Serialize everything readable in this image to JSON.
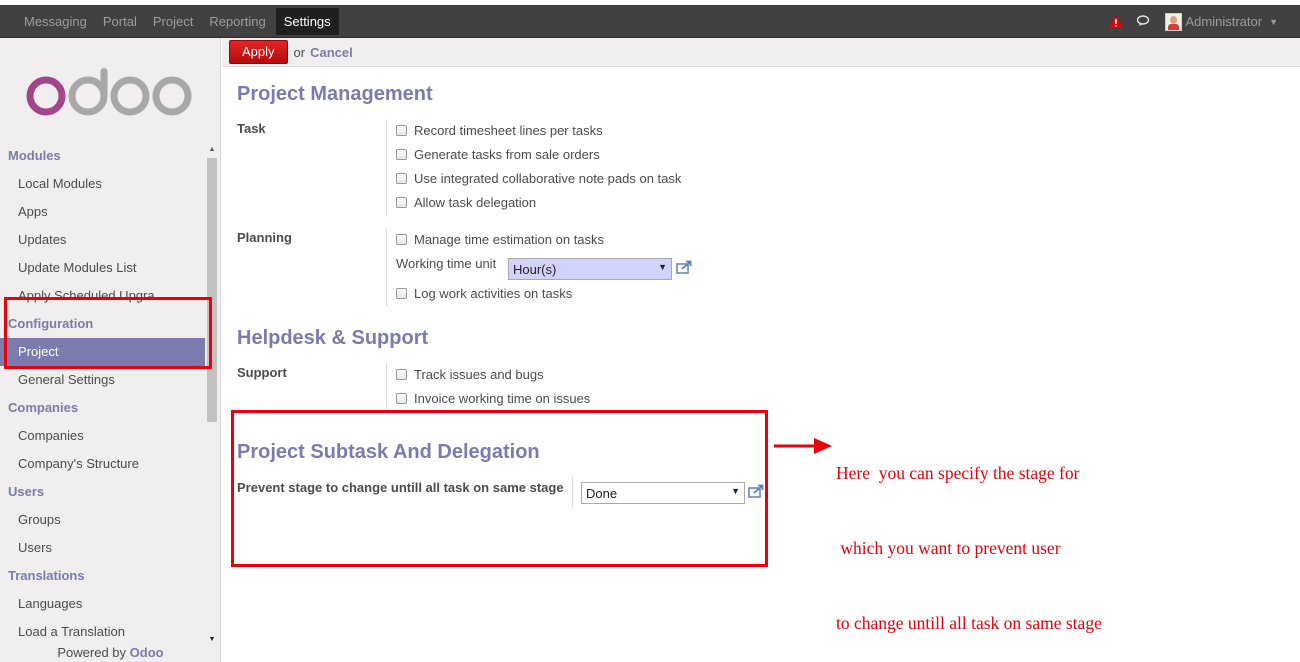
{
  "topbar": {
    "menu": [
      "Messaging",
      "Portal",
      "Project",
      "Reporting",
      "Settings"
    ],
    "active_menu": "Settings",
    "user_name": "Administrator"
  },
  "sidebar": {
    "sections": [
      {
        "title": "Modules",
        "items": [
          "Local Modules",
          "Apps",
          "Updates",
          "Update Modules List",
          "Apply Scheduled Upgra..."
        ]
      },
      {
        "title": "Configuration",
        "items": [
          "Project",
          "General Settings"
        ]
      },
      {
        "title": "Companies",
        "items": [
          "Companies",
          "Company's Structure"
        ]
      },
      {
        "title": "Users",
        "items": [
          "Groups",
          "Users"
        ]
      },
      {
        "title": "Translations",
        "items": [
          "Languages",
          "Load a Translation"
        ]
      }
    ],
    "active_item": "Project",
    "powered_by_prefix": "Powered by",
    "powered_by_brand": "Odoo"
  },
  "actionbar": {
    "apply_label": "Apply",
    "or_label": "or",
    "cancel_label": "Cancel"
  },
  "project_management": {
    "title": "Project Management",
    "task": {
      "label": "Task",
      "options": [
        "Record timesheet lines per tasks",
        "Generate tasks from sale orders",
        "Use integrated collaborative note pads on task",
        "Allow task delegation"
      ]
    },
    "planning": {
      "label": "Planning",
      "option_estimation": "Manage time estimation on tasks",
      "working_time_label": "Working time unit",
      "working_time_value": "Hour(s)",
      "option_log": "Log work activities on tasks"
    }
  },
  "helpdesk": {
    "title": "Helpdesk & Support",
    "support": {
      "label": "Support",
      "options": [
        "Track issues and bugs",
        "Invoice working time on issues"
      ]
    }
  },
  "subtask": {
    "title": "Project Subtask And Delegation",
    "prevent_label": "Prevent stage to change untill all task on same stage",
    "prevent_value": "Done"
  },
  "annotation": {
    "lines": [
      "Here  you can specify the stage for",
      " which you want to prevent user",
      "to change untill all task on same stage"
    ]
  },
  "colors": {
    "accent": "#7c7bad",
    "highlight": "#e8000b",
    "topbar": "#414141",
    "apply": "#d00e0e"
  }
}
